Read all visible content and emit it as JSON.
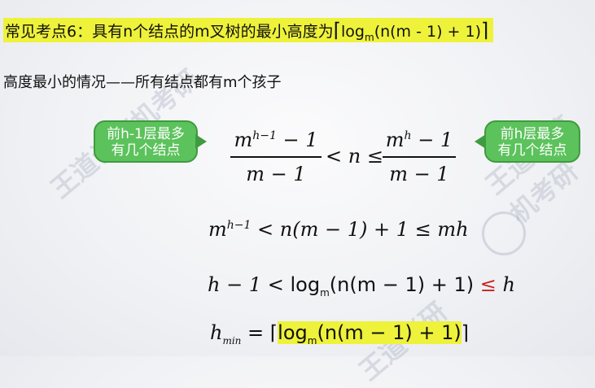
{
  "title": {
    "prefix": "常见考点6：具有n个结点的m叉树的最小高度为",
    "formula_log": "log",
    "formula_base": "m",
    "formula_args": "(n(m - 1) + 1)"
  },
  "subtitle": "高度最小的情况——所有结点都有m个孩子",
  "bubbles": {
    "left": "前h-1层最多\n有几个结点",
    "left_line1": "前h-1层最多",
    "left_line2": "有几个结点",
    "right_line1": "前h层最多",
    "right_line2": "有几个结点"
  },
  "eq1": {
    "num_left": "m",
    "num_left_exp": "h−1",
    "num_left_tail": " − 1",
    "den_left": "m − 1",
    "middle": "< n ≤",
    "num_right": "m",
    "num_right_exp": "h",
    "num_right_tail": " − 1",
    "den_right": "m − 1"
  },
  "eq2": {
    "base": "m",
    "exp": "h−1",
    "rest": " < n(m − 1) + 1 ≤ mh"
  },
  "eq3": {
    "lhs": "h − 1 < ",
    "log": "log",
    "base": "m",
    "args": "(n(m − 1) + 1)",
    "le": "≤",
    "rhs": " h"
  },
  "eq4": {
    "h": "h",
    "sub": "min",
    "eq": " = ",
    "log": "log",
    "base": "m",
    "args": "(n(m − 1) + 1)"
  },
  "watermarks": [
    "王道计算机考研",
    "王道计算机考研",
    "王道考研"
  ],
  "colors": {
    "highlight": "#eef23a",
    "bubble": "#5cc25c",
    "red": "#c81e1e"
  }
}
